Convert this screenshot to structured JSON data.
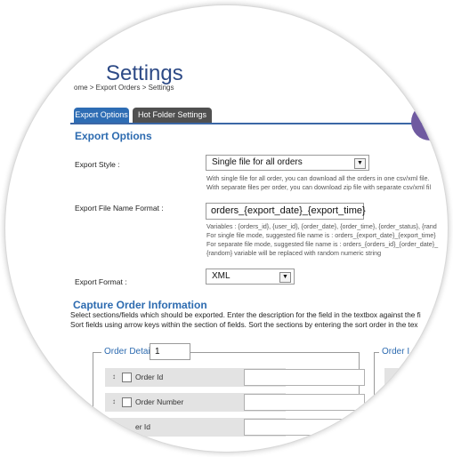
{
  "header": {
    "title": "Settings",
    "breadcrumb": "ome > Export Orders > Settings"
  },
  "tabs": [
    {
      "label": "Export Options",
      "active": true
    },
    {
      "label": "Hot Folder Settings",
      "active": false
    }
  ],
  "export_options": {
    "heading": "Export Options",
    "style_label": "Export Style :",
    "style_value": "Single file for all orders",
    "style_help": [
      "With single file for all order, you can download all the orders in one csv/xml file.",
      "With separate files per order, you can download zip file with separate csv/xml fil"
    ],
    "filename_label": "Export File Name Format :",
    "filename_value": "orders_{export_date}_{export_time}",
    "filename_help": [
      "Variables : {orders_id}, {user_id}, {order_date}, {order_time}, {order_status}, {rand",
      "For single file mode, suggested file name is : orders_{export_date}_{export_time}",
      "For separate file mode, suggested file name is : orders_{orders_id}_{order_date}_",
      "{random} variable will be replaced with random numeric string"
    ],
    "format_label": "Export Format :",
    "format_value": "XML"
  },
  "capture": {
    "heading": "Capture Order Information",
    "desc": [
      "Select sections/fields which should be exported. Enter the description for the field in the textbox against the fi",
      "Sort fields using arrow keys within the section of fields. Sort the sections by entering the sort order in the tex"
    ]
  },
  "order_details": {
    "legend": "Order Details",
    "sort_value": "1",
    "fields": [
      {
        "label": "Order Id",
        "sort_icon": "↕"
      },
      {
        "label": "Order Number",
        "sort_icon": "↕"
      },
      {
        "label": "er Id"
      }
    ]
  },
  "second_group": {
    "legend": "Order I"
  },
  "colors": {
    "accent": "#2e6db4",
    "tab_inactive": "#505050",
    "marker": "#6f5aa0"
  },
  "icons": {
    "dropdown": "chevron-down-icon",
    "sort": "sort-arrows-icon"
  }
}
